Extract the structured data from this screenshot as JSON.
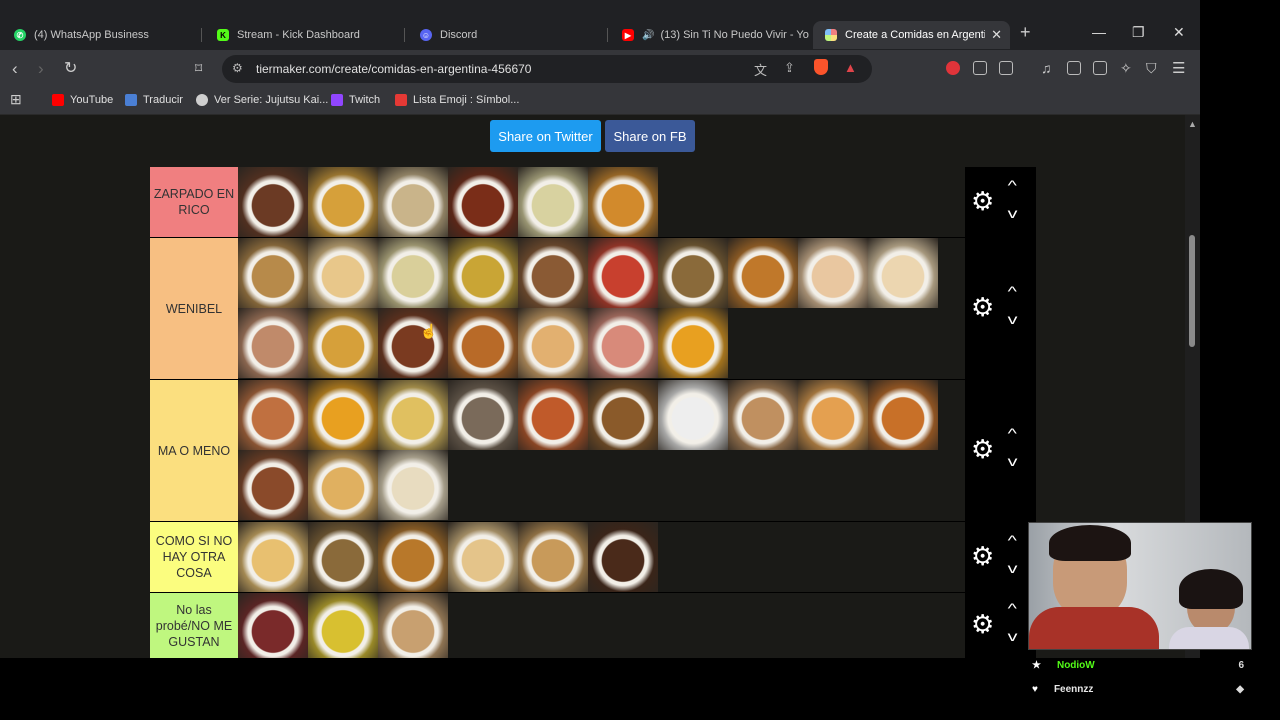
{
  "tabs": [
    {
      "label": "(4) WhatsApp Business",
      "favicon": "whatsapp-icon",
      "color": "#25d366"
    },
    {
      "label": "Stream - Kick Dashboard",
      "favicon": "kick-icon",
      "color": "#53fc18"
    },
    {
      "label": "Discord",
      "favicon": "discord-icon",
      "color": "#5865f2"
    },
    {
      "label": "(13) Sin Ti No Puedo Vivir - Yo",
      "favicon": "youtube-icon",
      "color": "#ff0000"
    },
    {
      "label": "Create a Comidas en Argentin",
      "favicon": "tiermaker-icon",
      "color": "#f2c94c"
    }
  ],
  "address_bar": {
    "url": "tiermaker.com/create/comidas-en-argentina-456670"
  },
  "bookmarks": [
    {
      "label": "YouTube",
      "icon": "youtube-icon",
      "color": "#ff0000"
    },
    {
      "label": "Traducir",
      "icon": "translate-icon",
      "color": "#4a7fd4"
    },
    {
      "label": "Ver Serie: Jujutsu Kai...",
      "icon": "globe-icon",
      "color": "#cfcfcf"
    },
    {
      "label": "Twitch",
      "icon": "twitch-icon",
      "color": "#9146ff"
    },
    {
      "label": "Lista Emoji : Símbol...",
      "icon": "flash-icon",
      "color": "#e53935"
    }
  ],
  "share": {
    "twitter": "Share on Twitter",
    "fb": "Share on FB"
  },
  "tiers": [
    {
      "label": "ZARPADO EN RICO",
      "color": "#f07f80",
      "item_count": 6,
      "items": [
        "#6b3a24",
        "#d6a03a",
        "#c9b48a",
        "#7a2d18",
        "#d8d2a0",
        "#d28a2c"
      ]
    },
    {
      "label": "WENIBEL",
      "color": "#f7bf82",
      "item_count": 17,
      "items": [
        "#b78a4a",
        "#e8c78a",
        "#d9cf9a",
        "#c9a535",
        "#8a5a34",
        "#c8402e",
        "#8a6a3a",
        "#c0782a",
        "#e9c7a0",
        "#ecd6b0",
        "#c08a6a",
        "#d6a03a",
        "#7a3a20",
        "#b86a28",
        "#e2b070",
        "#d88a7a",
        "#e8a020",
        "#c05a50"
      ]
    },
    {
      "label": "MA O MENO",
      "color": "#fbdf7f",
      "item_count": 13,
      "items": [
        "#c07040",
        "#e8a020",
        "#e0c060",
        "#7a6a5a",
        "#c05a2a",
        "#8a5a2a",
        "#eeeeee",
        "#c09060",
        "#e4a050",
        "#c87028",
        "#8a4a2a",
        "#e0b060",
        "#e8dcc0"
      ]
    },
    {
      "label": "COMO SI NO HAY OTRA COSA",
      "color": "#fbfd7f",
      "item_count": 6,
      "items": [
        "#e8c070",
        "#8a6a3a",
        "#b8782a",
        "#e4c48a",
        "#c89a5a",
        "#4a2a1a"
      ]
    },
    {
      "label": "No las probé/NO ME GUSTAN",
      "color": "#bff77f",
      "item_count": 3,
      "items": [
        "#7a2a2a",
        "#d8c030",
        "#c8a070"
      ]
    }
  ],
  "overlay": {
    "chat": [
      {
        "user": "NodioW",
        "color": "#53fc18",
        "count": "6"
      },
      {
        "user": "Feennzz",
        "color": "#e8e8e8",
        "count": ""
      }
    ]
  }
}
